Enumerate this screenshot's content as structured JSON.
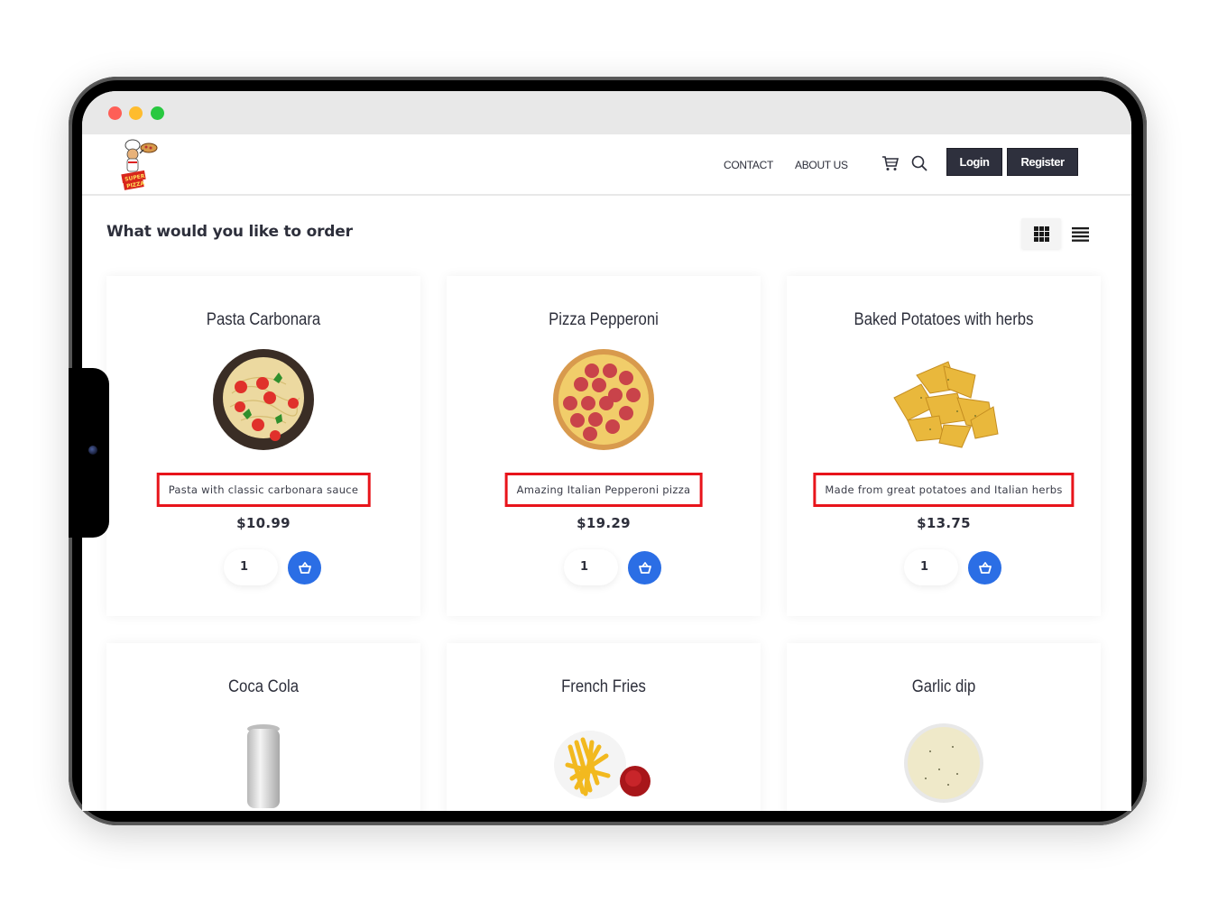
{
  "window": {
    "controls": [
      "close",
      "minimize",
      "maximize"
    ]
  },
  "navbar": {
    "logo_alt": "Super Pizza",
    "links": [
      {
        "label": "CONTACT"
      },
      {
        "label": "ABOUT US"
      }
    ],
    "icons": [
      "cart-icon",
      "search-icon"
    ],
    "login_label": "Login",
    "register_label": "Register"
  },
  "main": {
    "heading": "What would you like to order",
    "view_modes": [
      {
        "name": "grid",
        "icon": "grid-icon",
        "active": true
      },
      {
        "name": "list",
        "icon": "list-icon",
        "active": false
      }
    ],
    "products": [
      {
        "title": "Pasta Carbonara",
        "description": "Pasta with classic carbonara sauce",
        "price": "$10.99",
        "quantity": "1",
        "image": "pasta-image"
      },
      {
        "title": "Pizza Pepperoni",
        "description": "Amazing Italian Pepperoni pizza",
        "price": "$19.29",
        "quantity": "1",
        "image": "pizza-image"
      },
      {
        "title": "Baked Potatoes with herbs",
        "description": "Made from great potatoes and Italian herbs",
        "price": "$13.75",
        "quantity": "1",
        "image": "potatoes-image"
      },
      {
        "title": "Coca Cola",
        "image": "can-image"
      },
      {
        "title": "French Fries",
        "image": "fries-image"
      },
      {
        "title": "Garlic dip",
        "image": "dip-image"
      }
    ]
  },
  "colors": {
    "accent_blue": "#2b6ee5",
    "dark_button": "#2e303d",
    "highlight_red": "#e8141b",
    "text_dark": "#2d2f3b"
  }
}
